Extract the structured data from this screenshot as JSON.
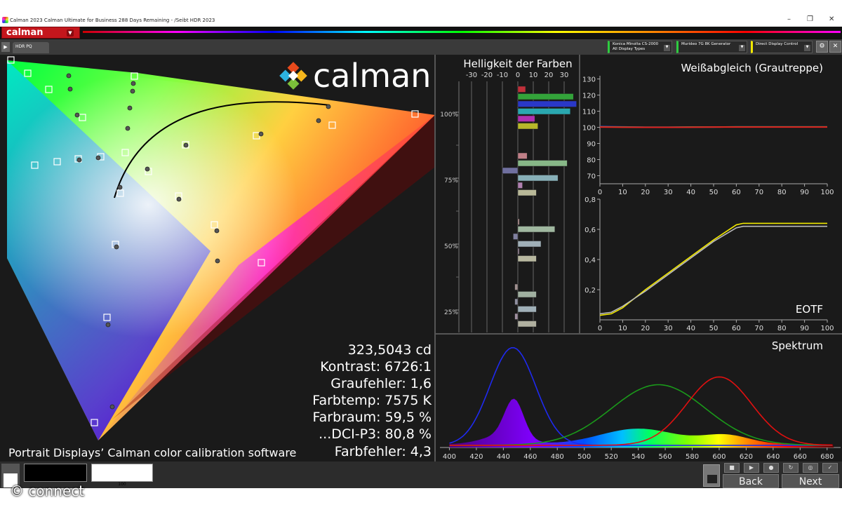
{
  "window": {
    "title": "Calman 2023 Calman Ultimate for Business 288 Days Remaining  - /Seibt HDR 2023",
    "controls": [
      "–",
      "❐",
      "✕"
    ]
  },
  "app": {
    "logo_label": "calman",
    "tab": "HDR PQ",
    "devices": [
      {
        "line1": "Konica Minolta CS-2000",
        "line2": "All Display Types",
        "color": "#2ecc40"
      },
      {
        "line1": "Murideo 7G 8K Generator",
        "line2": "",
        "color": "#2ecc40"
      },
      {
        "line1": "Direct Display Control",
        "line2": "",
        "color": "#f1e800"
      }
    ]
  },
  "cie": {
    "watermark": "calman",
    "stats": [
      "323,5043 cd",
      "Kontrast: 6726:1",
      "Graufehler: 1,6",
      "Farbtemp: 7575 K",
      "Farbraum: 59,5 %",
      "...DCI-P3: 80,8 %",
      "Farbfehler: 4,3"
    ],
    "credit": "Portrait Displays’ Calman color calibration software"
  },
  "luminance_chart": {
    "title": "Helligkeit der Farben",
    "x_ticks": [
      "-30",
      "-20",
      "-10",
      "0",
      "10",
      "20",
      "30"
    ],
    "y_labels": [
      "100%",
      "75%",
      "50%",
      "25%"
    ]
  },
  "charts": {
    "whitebalance": {
      "title": "Weißabgleich (Grautreppe)",
      "x_ticks": [
        "0",
        "10",
        "20",
        "30",
        "40",
        "50",
        "60",
        "70",
        "80",
        "90",
        "100"
      ],
      "y_ticks": [
        "130",
        "120",
        "110",
        "100",
        "90",
        "80",
        "70"
      ]
    },
    "eotf": {
      "title": "EOTF",
      "x_ticks": [
        "0",
        "10",
        "20",
        "30",
        "40",
        "50",
        "60",
        "70",
        "80",
        "90",
        "100"
      ],
      "y_ticks": [
        "0,8",
        "0,6",
        "0,4",
        "0,2"
      ]
    },
    "spectrum": {
      "title": "Spektrum",
      "x_ticks": [
        "400",
        "420",
        "440",
        "460",
        "480",
        "500",
        "520",
        "540",
        "560",
        "580",
        "600",
        "620",
        "640",
        "660",
        "680"
      ]
    }
  },
  "chart_data": [
    {
      "type": "line",
      "title": "Weißabgleich (Grautreppe)",
      "x": [
        0,
        10,
        20,
        30,
        40,
        50,
        60,
        70,
        80,
        90,
        100
      ],
      "ylim": [
        65,
        132
      ],
      "series": [
        {
          "values": [
            100.5,
            100.3,
            100.1,
            100.1,
            100.2,
            100.2,
            100.3,
            100.3,
            100.3,
            100.3,
            100.3
          ],
          "color": "#2a3ae0"
        },
        {
          "values": [
            100.3,
            100.2,
            100.1,
            100.1,
            100.2,
            100.2,
            100.3,
            100.3,
            100.3,
            100.3,
            100.3
          ],
          "color": "#2ecc40"
        },
        {
          "values": [
            100.2,
            100.1,
            100.0,
            100.0,
            100.1,
            100.2,
            100.2,
            100.2,
            100.2,
            100.2,
            100.2
          ],
          "color": "#e02020"
        }
      ]
    },
    {
      "type": "line",
      "title": "EOTF",
      "x": [
        0,
        5,
        10,
        20,
        30,
        40,
        50,
        60,
        63,
        70,
        80,
        90,
        100
      ],
      "ylim": [
        0,
        0.8
      ],
      "series": [
        {
          "values": [
            0.03,
            0.04,
            0.08,
            0.2,
            0.31,
            0.42,
            0.53,
            0.63,
            0.64,
            0.64,
            0.64,
            0.64,
            0.64
          ],
          "color": "#f1e800"
        },
        {
          "values": [
            0.04,
            0.05,
            0.09,
            0.19,
            0.3,
            0.41,
            0.52,
            0.61,
            0.62,
            0.62,
            0.62,
            0.62,
            0.62
          ],
          "color": "#bbbbbb"
        }
      ]
    },
    {
      "type": "bar",
      "title": "Helligkeit der Farben",
      "xlim": [
        -35,
        40
      ],
      "categories": [
        "100% R",
        "100% G",
        "100% B",
        "100% C",
        "100% M",
        "100% Y",
        "75% R",
        "75% G",
        "75% B",
        "75% C",
        "75% M",
        "75% Y",
        "50% R",
        "50% G",
        "50% B",
        "50% C",
        "50% M",
        "50% Y",
        "25% R",
        "25% G",
        "25% B",
        "25% C",
        "25% M",
        "25% Y"
      ],
      "values": [
        5,
        36,
        38,
        34,
        11,
        13,
        6,
        32,
        -10,
        26,
        3,
        12,
        1,
        24,
        -3,
        15,
        0,
        12,
        -2,
        12,
        -2,
        12,
        -2,
        12
      ],
      "colors": [
        "#c0303a",
        "#33a33a",
        "#2a38c8",
        "#2aa8b0",
        "#b030b0",
        "#b8b82a",
        "#c08088",
        "#88b888",
        "#7070a0",
        "#88b0b8",
        "#b080b0",
        "#b8b898",
        "#b09090",
        "#a0b8a0",
        "#8080a0",
        "#a0b0b8",
        "#a08ca0",
        "#b8b8a0",
        "#a09090",
        "#a0b0a0",
        "#9090a0",
        "#a0b0b8",
        "#a090a0",
        "#b0b0a0"
      ]
    },
    {
      "type": "line",
      "title": "Spektrum",
      "xlim": [
        393,
        690
      ],
      "series": [
        {
          "name": "B",
          "color": "#1f2af0",
          "peak": 447,
          "width": 17,
          "height": 1.0
        },
        {
          "name": "G",
          "color": "#1a9a1a",
          "peak": 555,
          "width": 35,
          "height": 0.62
        },
        {
          "name": "R",
          "color": "#e01010",
          "peak": 600,
          "width": 24,
          "height": 0.7
        }
      ]
    }
  ]
}
